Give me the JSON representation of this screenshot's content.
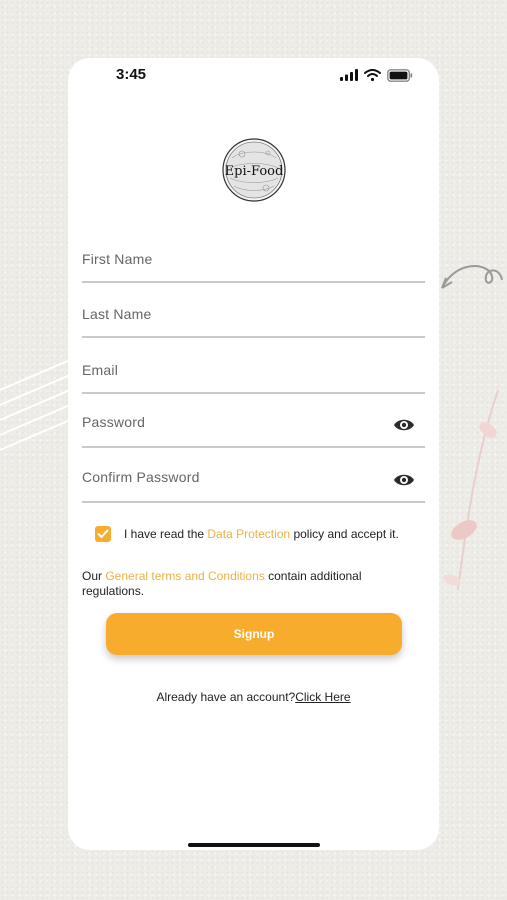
{
  "status_bar": {
    "time": "3:45"
  },
  "brand": {
    "logo_text": "Epi-Food"
  },
  "form": {
    "first_name": {
      "placeholder": "First Name",
      "value": ""
    },
    "last_name": {
      "placeholder": "Last Name",
      "value": ""
    },
    "email": {
      "placeholder": "Email",
      "value": ""
    },
    "password": {
      "placeholder": "Password",
      "value": ""
    },
    "confirm_password": {
      "placeholder": "Confirm Password",
      "value": ""
    }
  },
  "consent": {
    "checked": true,
    "prefix": "I have read the ",
    "link": "Data Protection",
    "suffix": " policy and accept it."
  },
  "terms": {
    "prefix": "Our ",
    "link": "General terms and Conditions",
    "suffix": " contain additional regulations."
  },
  "signup_button": {
    "label": "Signup"
  },
  "login": {
    "prompt": "Already have an account?",
    "link": "Click Here"
  },
  "colors": {
    "accent": "#f8ac2d",
    "link": "#e8b246",
    "background": "#eeece6"
  },
  "icons": {
    "visibility": "eye-icon",
    "check": "checkmark-icon",
    "signal": "cellular-signal-icon",
    "wifi": "wifi-icon",
    "battery": "battery-icon"
  }
}
